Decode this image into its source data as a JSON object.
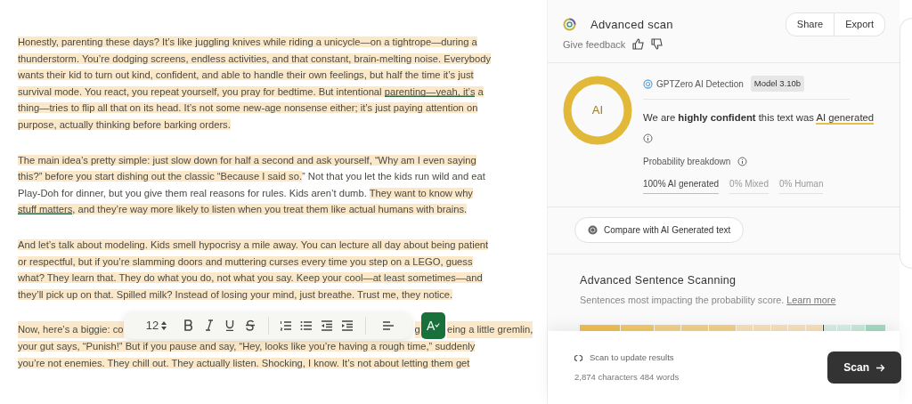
{
  "editor": {
    "paragraphs": [
      {
        "lines": [
          [
            {
              "text": "Honestly, parenting these days? It’s like juggling knives while riding a unicycle—on a tightrope—during a",
              "highlighted": true,
              "underlined": false
            }
          ],
          [
            {
              "text": "thunderstorm. You’re dodging screens, endless activities, and that constant, brain-melting noise. Everybody",
              "highlighted": true,
              "underlined": false
            }
          ],
          [
            {
              "text": "wants their kid to turn out kind, confident, and able to handle their own feelings, but half the time it’s just",
              "highlighted": true,
              "underlined": false
            }
          ],
          [
            {
              "text": "survival mode. You react, you repeat yourself, you pray for bedtime. But intentional ",
              "highlighted": true,
              "underlined": false
            },
            {
              "text": "parenting—yeah, it’s",
              "highlighted": true,
              "underlined": true
            },
            {
              "text": " a",
              "highlighted": true,
              "underlined": false
            }
          ],
          [
            {
              "text": "thing—tries to flip all that on its head. It’s not some new-age nonsense either; it’s just paying attention on",
              "highlighted": true,
              "underlined": false
            }
          ],
          [
            {
              "text": "purpose, actually thinking before barking orders.",
              "highlighted": true,
              "underlined": false
            }
          ]
        ]
      },
      {
        "lines": [
          [
            {
              "text": "The main idea’s pretty simple: just slow down for half a second and ask yourself, “Why am I even saying",
              "highlighted": true,
              "underlined": false
            }
          ],
          [
            {
              "text": "this?” before you start dishing out the classic “Because I said so.",
              "highlighted": true,
              "underlined": false
            },
            {
              "text": "” Not that you let the kids run wild and eat",
              "highlighted": false,
              "underlined": false
            }
          ],
          [
            {
              "text": "Play-Doh for dinner, but you give them real reasons for rules. Kids aren’t dumb. ",
              "highlighted": false,
              "underlined": false
            },
            {
              "text": "They want to know why",
              "highlighted": true,
              "underlined": false
            }
          ],
          [
            {
              "text": "stuff matters",
              "highlighted": true,
              "underlined": true
            },
            {
              "text": ", and they’re way more likely to listen when you treat them like actual humans with brains.",
              "highlighted": true,
              "underlined": false
            }
          ]
        ]
      },
      {
        "lines": [
          [
            {
              "text": "And let’s talk about modeling. Kids smell hypocrisy a mile away. You can lecture all day about being patient",
              "highlighted": true,
              "underlined": false
            }
          ],
          [
            {
              "text": "or respectful, but if you’re slamming doors and muttering curses every time you step on a LEGO, guess",
              "highlighted": true,
              "underlined": false
            }
          ],
          [
            {
              "text": "what? They learn that. They do what you do, not what you say. Keep your cool—at least sometimes—and",
              "highlighted": true,
              "underlined": false
            }
          ],
          [
            {
              "text": "they’ll pick up on that. Spilled milk? Instead of losing your mind, just breathe. Trust me, they notice.",
              "highlighted": true,
              "underlined": false
            }
          ]
        ]
      },
      {
        "lines": [
          [
            {
              "text": "Now, here’s a biggie: co",
              "highlighted": true,
              "underlined": false
            },
            {
              "kind": "toolbar"
            },
            {
              "text": "g ",
              "highlighted": true,
              "underlined": false
            },
            {
              "kind": "fab"
            },
            {
              "text": "eing a little gremlin,",
              "highlighted": true,
              "underlined": false
            }
          ],
          [
            {
              "text": "your gut says, “Punish!” But if you pause and say, “Hey, looks like you’re having a rough time,” suddenly",
              "highlighted": true,
              "underlined": false
            }
          ],
          [
            {
              "text": "you’re not enemies. They chill out. They actually listen. Shocking, I know. It’s not about letting them get",
              "highlighted": true,
              "underlined": false
            }
          ]
        ]
      }
    ]
  },
  "toolbar": {
    "font_size": "12",
    "fab": {
      "label": "A"
    }
  },
  "panel": {
    "title": "Advanced scan",
    "buttons": [
      "Share",
      "Export"
    ],
    "feedback": "Give feedback",
    "result": {
      "ring": {
        "label": "AI",
        "level": 1
      },
      "source": "GPTZero AI Detection",
      "model": "Model 3.10b",
      "verdict": "We are **highly confident** this text was ",
      "verdict_emphasis": "AI generated",
      "breakdown_label": "Probability breakdown",
      "breakdown": [
        {
          "label": "100% AI generated",
          "selected": true
        },
        {
          "label": "0% Mixed",
          "selected": false
        },
        {
          "label": "0% Human",
          "selected": false
        }
      ]
    },
    "compare": "Compare with AI Generated text",
    "sentences": {
      "title": "Advanced Sentence Scanning",
      "subtitle": "Sentences most impacting the probability score. ",
      "link": "Learn more",
      "segments": [
        {
          "color": "#f0bf55"
        },
        {
          "color": "#f2c96b"
        },
        {
          "color": "#f4d18a"
        },
        {
          "color": "#f4d18a"
        },
        {
          "color": "#f4d18a"
        },
        {
          "color": "#f8e2ba"
        },
        {
          "color": "#f8e2ba"
        },
        {
          "color": "#f8e2ba"
        },
        {
          "color": "#f8e2ba"
        },
        {
          "color": "#f8e2ba"
        },
        {
          "color": "#d7efe5"
        },
        {
          "color": "#d7efe5"
        },
        {
          "color": "#c9eadb"
        },
        {
          "color": "#a4dcc2"
        }
      ],
      "marker": {
        "level": 0.795
      }
    },
    "footer": {
      "status": "Scan to update results",
      "counts": "2,874 characters 484 words",
      "scan": "Scan"
    }
  }
}
